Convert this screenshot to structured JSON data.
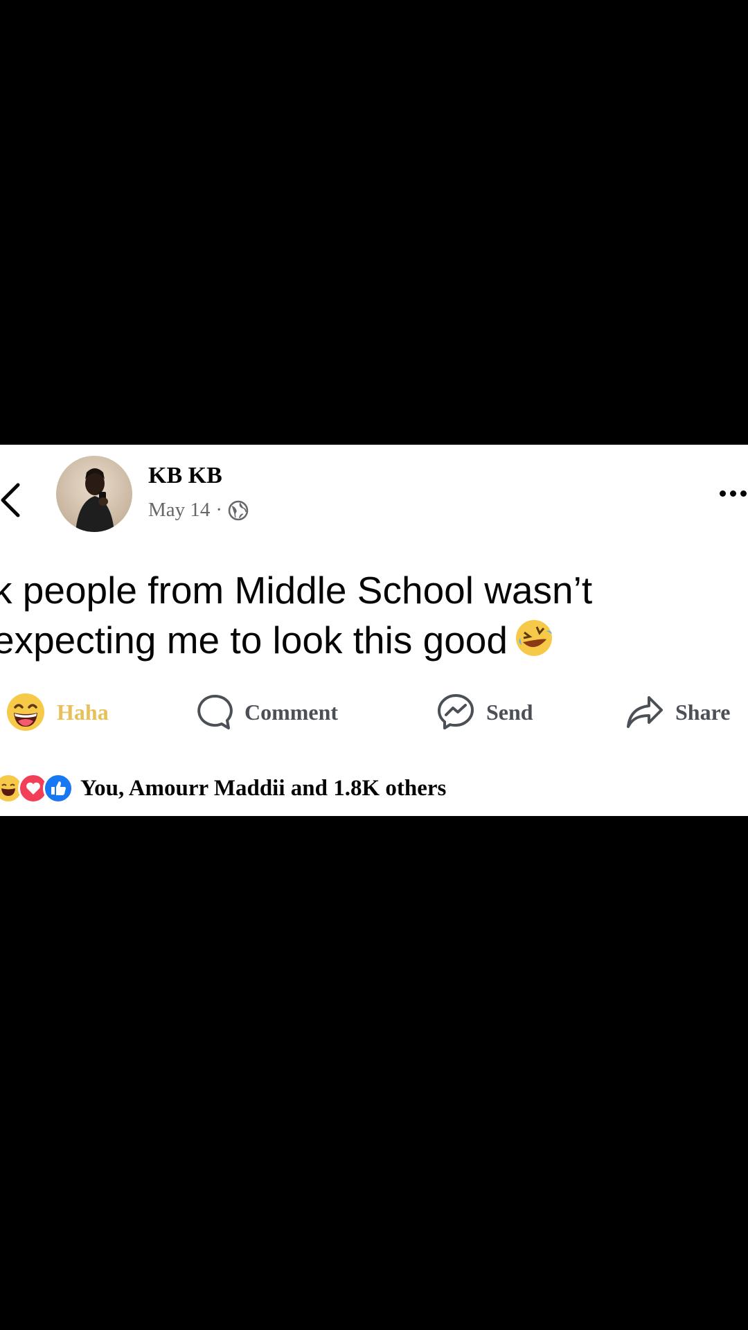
{
  "post": {
    "author_name": "KB KB",
    "date": "May 14",
    "separator": "·",
    "privacy_icon": "globe-icon",
    "text_line_1": "k people from Middle School wasn’t",
    "text_line_2": "expecting me to look this good"
  },
  "actions": {
    "haha_label": "Haha",
    "comment_label": "Comment",
    "send_label": "Send",
    "share_label": "Share"
  },
  "reactions": {
    "summary": "You, Amourr Maddii and 1.8K others",
    "icons": [
      "haha-icon",
      "love-icon",
      "like-icon"
    ]
  },
  "colors": {
    "haha_active": "#e8c05a",
    "like_blue": "#1877f2",
    "love_red": "#f33e58",
    "muted_text": "#65676b"
  }
}
